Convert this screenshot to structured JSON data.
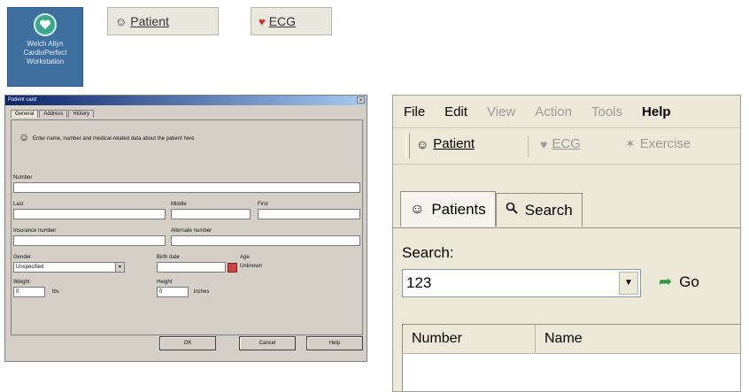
{
  "desktop_icon": {
    "label": "Welch Allyn\nCardioPerfect\nWorkstation",
    "icon": "heart-icon"
  },
  "top_buttons": [
    {
      "label": "Patient",
      "icon": "patient-icon"
    },
    {
      "label": "ECG",
      "icon": "ecg-icon"
    }
  ],
  "patient_dialog": {
    "title": "Patient card",
    "tabs": [
      "General",
      "Address",
      "History"
    ],
    "description": "Enter name, number and medical-related data about the patient here",
    "fields": {
      "number_label": "Number",
      "last_label": "Last",
      "middle_label": "Middle",
      "first_label": "First",
      "insurance_label": "Insurance number",
      "alternate_label": "Alternate number",
      "gender_label": "Gender",
      "gender_value": "Unspecified",
      "birthdate_label": "Birth date",
      "age_label": "Age",
      "age_value": "Unknown",
      "weight_label": "Weight",
      "weight_value": "0",
      "weight_unit": "lbs",
      "height_label": "Height",
      "height_value": "0",
      "height_unit": "inches"
    },
    "buttons": {
      "ok": "OK",
      "cancel": "Cancel",
      "help": "Help"
    }
  },
  "app": {
    "menu": [
      "File",
      "Edit",
      "View",
      "Action",
      "Tools",
      "Help"
    ],
    "toolbar": [
      {
        "label": "Patient",
        "icon": "patient-icon",
        "enabled": true
      },
      {
        "label": "ECG",
        "icon": "ecg-icon",
        "enabled": false
      },
      {
        "label": "Exercise",
        "icon": "exercise-icon",
        "enabled": false
      }
    ],
    "tabs": [
      {
        "label": "Patients",
        "icon": "patient-icon"
      },
      {
        "label": "Search",
        "icon": "search-icon"
      }
    ],
    "search_label": "Search:",
    "search_value": "123",
    "go_label": "Go",
    "columns": [
      "Number",
      "Name"
    ]
  }
}
